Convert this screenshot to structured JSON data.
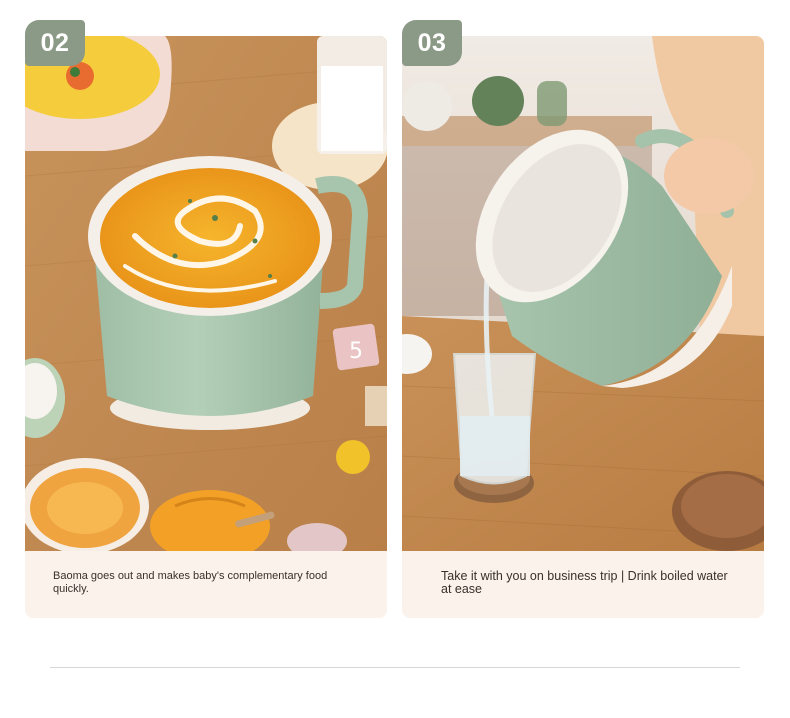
{
  "cards": [
    {
      "number": "02",
      "caption": "Baoma goes out and makes baby's complementary food quickly."
    },
    {
      "number": "03",
      "caption": "Take it with you on business trip | Drink boiled water at ease"
    }
  ],
  "colors": {
    "badge": "#8b9a86",
    "card_background": "#fbf2ec",
    "cup_green": "#a7c4ac",
    "soup": "#f2a822",
    "table_wood": "#c48f5c"
  }
}
